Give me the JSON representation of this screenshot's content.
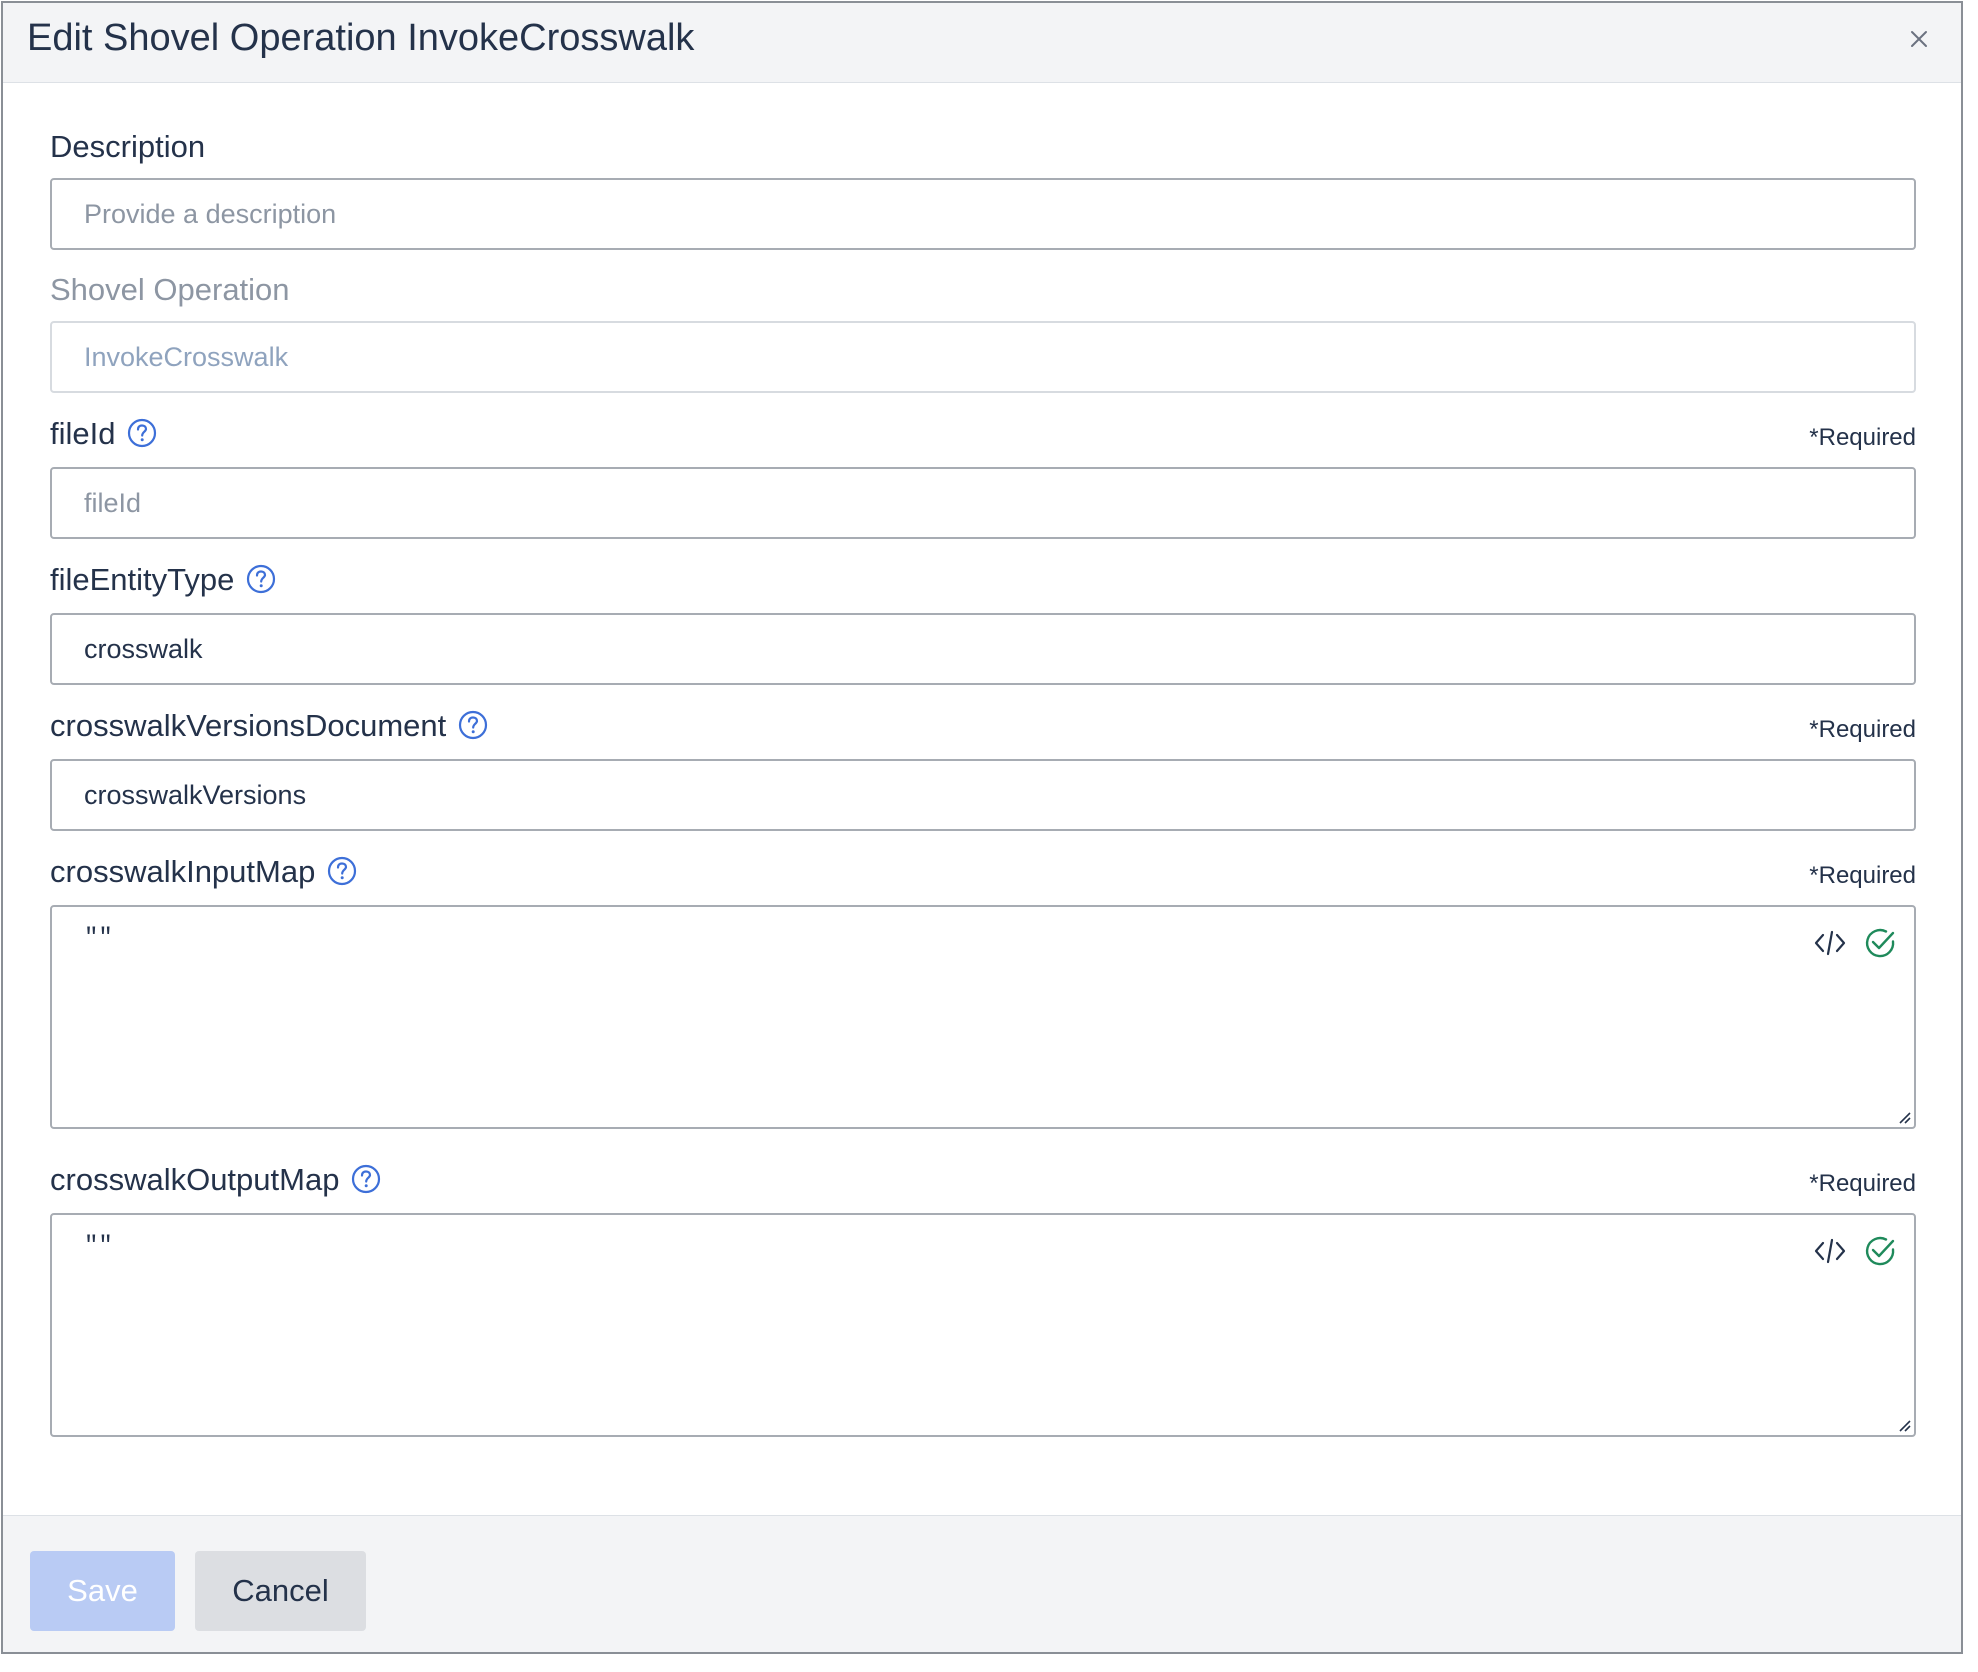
{
  "dialog": {
    "title": "Edit Shovel Operation InvokeCrosswalk",
    "close_icon": "close-icon"
  },
  "fields": {
    "description": {
      "label": "Description",
      "placeholder": "Provide a description",
      "value": ""
    },
    "shovel_operation": {
      "label": "Shovel Operation",
      "value": "InvokeCrosswalk",
      "disabled": true
    },
    "file_id": {
      "label": "fileId",
      "required": "*Required",
      "placeholder": "fileId",
      "value": ""
    },
    "file_entity_type": {
      "label": "fileEntityType",
      "value": "crosswalk"
    },
    "crosswalk_versions_document": {
      "label": "crosswalkVersionsDocument",
      "required": "*Required",
      "value": "crosswalkVersions"
    },
    "crosswalk_input_map": {
      "label": "crosswalkInputMap",
      "required": "*Required",
      "value": "\"\""
    },
    "crosswalk_output_map": {
      "label": "crosswalkOutputMap",
      "required": "*Required",
      "value": "\"\""
    }
  },
  "icons": {
    "help": "help-circle-icon",
    "code": "code-icon",
    "valid": "check-circle-icon"
  },
  "colors": {
    "help_icon": "#3d6fd8",
    "valid_icon": "#1f8a5b",
    "save_button_disabled": "#b9cbf4",
    "cancel_button": "#dcdee2"
  },
  "footer": {
    "save_label": "Save",
    "cancel_label": "Cancel"
  }
}
